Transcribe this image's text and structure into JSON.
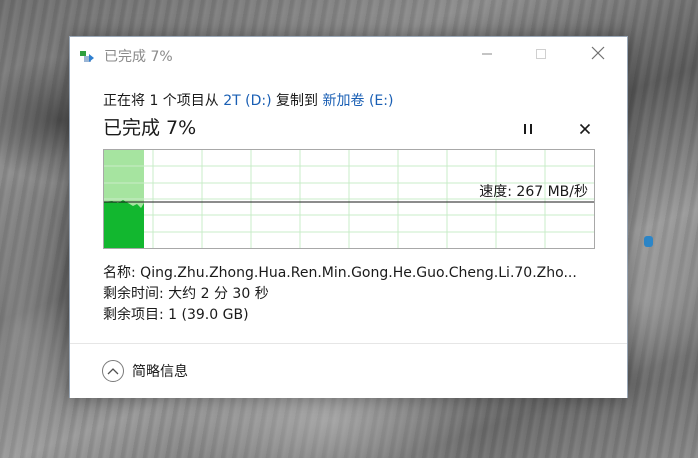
{
  "window": {
    "title": "已完成 7%"
  },
  "copy": {
    "prefix": "正在将 1 个项目从 ",
    "source": "2T (D:)",
    "middle": " 复制到 ",
    "destination": "新加卷 (E:)"
  },
  "status": {
    "text": "已完成 7%",
    "percent_complete": 7
  },
  "graph": {
    "speed_label": "速度: 267 MB/秒",
    "progress_fraction": 0.07
  },
  "details": {
    "name_label": "名称:",
    "name_value": "Qing.Zhu.Zhong.Hua.Ren.Min.Gong.He.Guo.Cheng.Li.70.Zho...",
    "time_label": "剩余时间:",
    "time_value": "大约 2 分 30 秒",
    "items_label": "剩余项目:",
    "items_value": "1 (39.0 GB)"
  },
  "footer": {
    "less_info_label": "简略信息"
  },
  "colors": {
    "link": "#1a5fb4",
    "graph_fill_light": "#a6e4a0",
    "graph_fill_dark": "#12b72f",
    "graph_grid": "#c9ecc9"
  },
  "icons": {
    "title": "copy-progress-icon",
    "minimize": "minimize-icon",
    "maximize": "maximize-icon",
    "close": "close-icon",
    "pause": "pause-icon",
    "cancel": "cancel-icon",
    "expand": "chevron-up-icon"
  }
}
